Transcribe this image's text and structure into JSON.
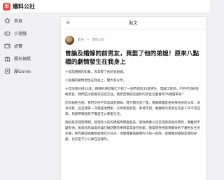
{
  "app": {
    "name": "爆料公社",
    "logo_glyph": "爆"
  },
  "sidebar": {
    "items": [
      {
        "label": "首頁",
        "icon": "home-icon"
      },
      {
        "label": "小遊戲",
        "icon": "gamepad-icon"
      },
      {
        "label": "虛寶",
        "icon": "wallet-icon"
      },
      {
        "label": "擺石抽獎",
        "icon": "gift-icon"
      },
      {
        "label": "爆Game",
        "icon": "controller-icon"
      }
    ]
  },
  "panel": {
    "title": "貼文",
    "close_glyph": "✕"
  },
  "post": {
    "author_name": "匿名",
    "community": "爆料公社",
    "separator": "•",
    "title": "曾論及婚嫁的前男友，竟娶了他的弟媳！原來八點檔的劇情發生在我身上",
    "paragraphs": [
      "十年前相親的對象，去年娶了他的弟媳婦。",
      "八點檔的劇情發生在我身上，實大家分享。",
      "十年前我已經32歲，媽媽的朋友幫忙介紹了一個不錯的35歲男生，電腦工程師，不菸不酒很性格善良，我們是以結婚為前提交往，我甚至懷疑這麼好的男生怎麼會到35歲還單身？",
      "因為個性合拍，我們交往半年就論及婚嫁，雙方都見過了面，我媽媽還直想去拜訪他的父母，他也同意，這是我第一次踏進他們家，父母客客氣氣，家境不錯，唯獨他的弟弟在北部工作不常回來，弟媳帶兩個孩子獨自在公婆家生活。",
      "我與男友開開時啊，發現有小孩的媳婦時間看起來，使喚婢婆小孩常常跑來他房間玩，我雖然不疑有他，後來因為誤會討論訂婚話題的事項常常會在他家，我發現性格發現婚後他下著男女生的衣服，那衣服是媽媽剛給我的大兒子，他解釋著照顧我的小孩一起陪，他媽媽說媳婦是我的好處，也許是不小心掉在這裡的。"
    ]
  }
}
